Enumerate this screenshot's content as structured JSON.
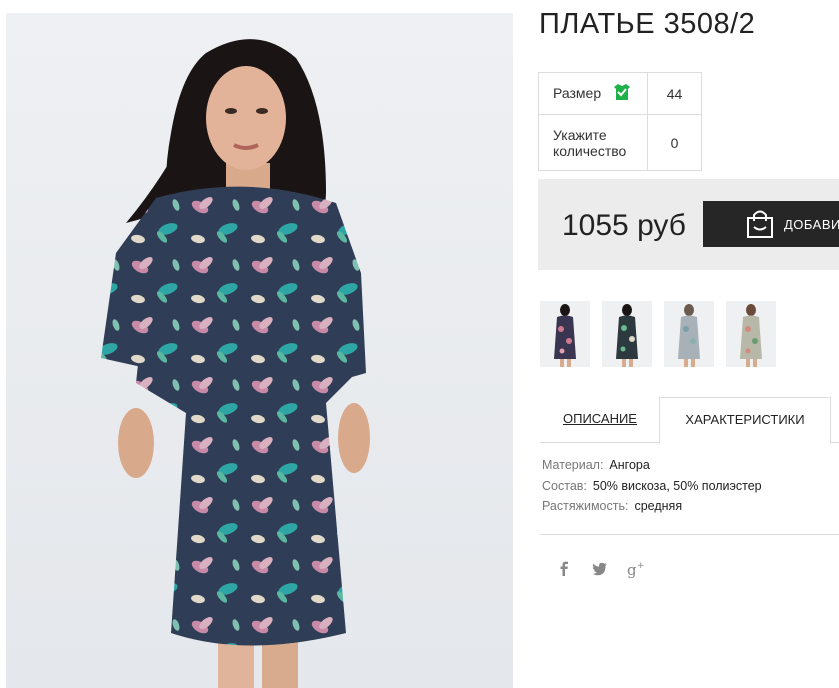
{
  "product": {
    "title": "ПЛАТЬЕ 3508/2",
    "size_label": "Размер",
    "size_value": "44",
    "qty_label": "Укажите количество",
    "qty_value": "0",
    "price": "1055 руб",
    "add_button_label": "ДОБАВИТЬ"
  },
  "thumbnails": [
    {
      "name": "thumbnail-1",
      "dress_color": "#3a3550"
    },
    {
      "name": "thumbnail-2",
      "dress_color": "#2c3a40"
    },
    {
      "name": "thumbnail-3",
      "dress_color": "#a9b1b8"
    },
    {
      "name": "thumbnail-4",
      "dress_color": "#b8b8a8"
    }
  ],
  "tabs": [
    {
      "label": "ОПИСАНИЕ",
      "active": false
    },
    {
      "label": "ХАРАКТЕРИСТИКИ",
      "active": true
    }
  ],
  "specs": [
    {
      "key": "Материал:",
      "value": "Ангора"
    },
    {
      "key": "Состав:",
      "value": "50% вискоза, 50% полиэстер"
    },
    {
      "key": "Растяжимость:",
      "value": "средняя"
    }
  ],
  "social": [
    "facebook-icon",
    "twitter-icon",
    "google-plus-icon"
  ],
  "colors": {
    "accent_check": "#1fb14a",
    "button_bg": "#262626",
    "price_bg": "#ececec"
  }
}
